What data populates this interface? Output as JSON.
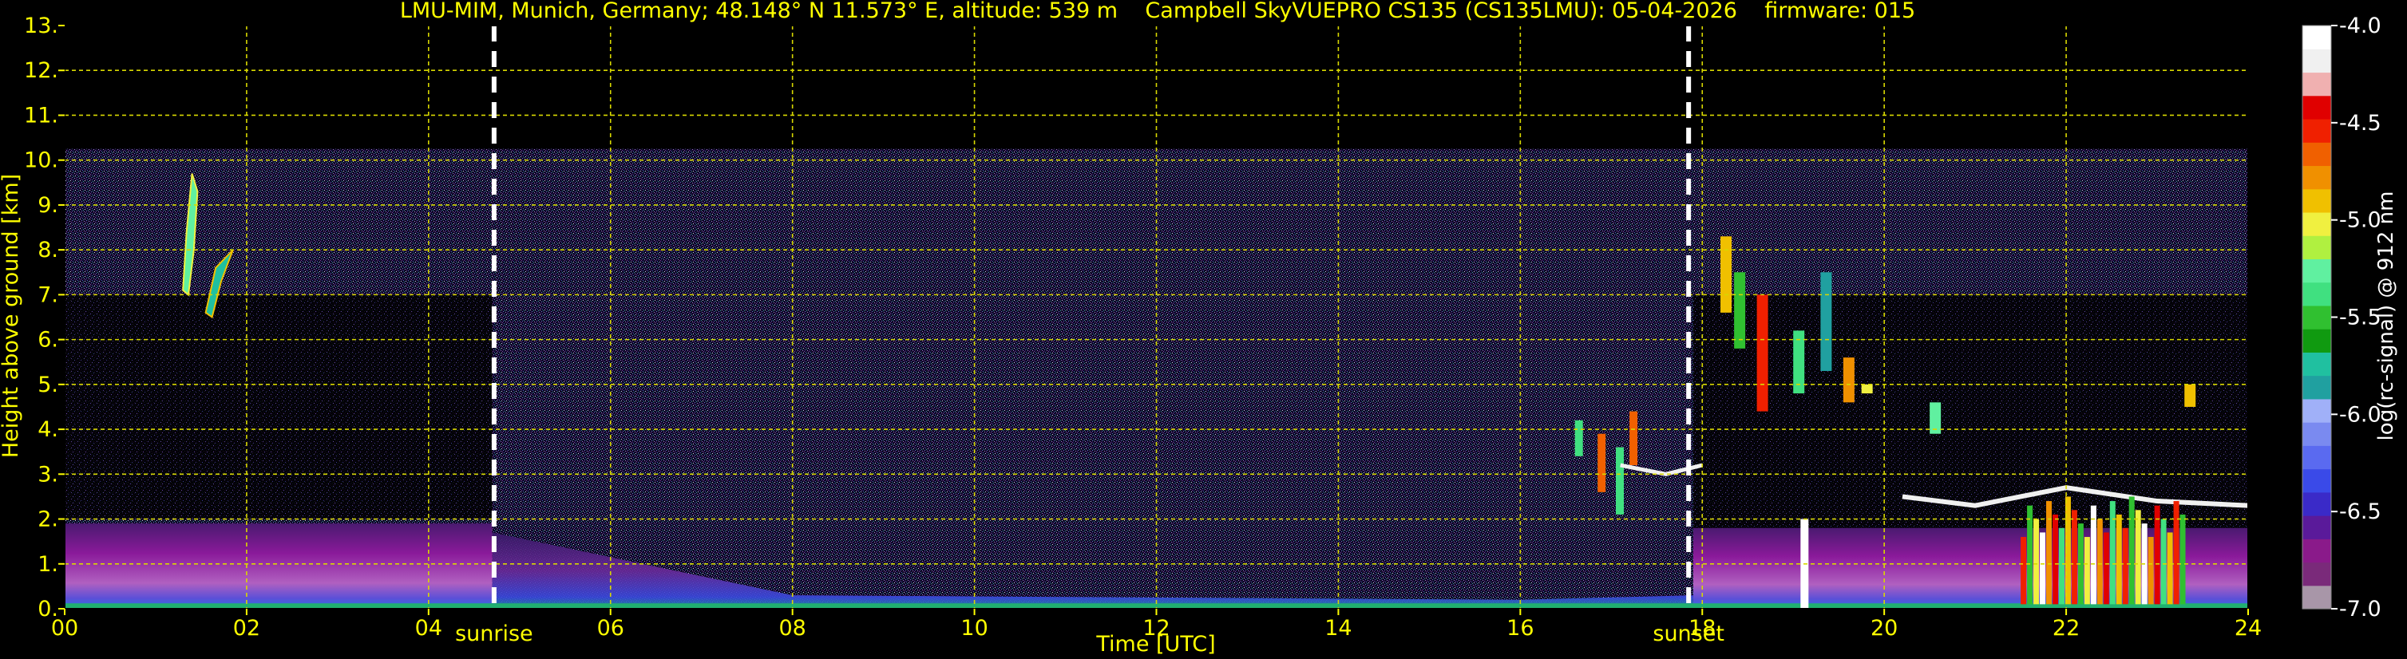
{
  "chart_data": {
    "type": "heatmap",
    "title": "LMU-MIM, Munich, Germany; 48.148° N 11.573° E, altitude: 539 m    Campbell SkyVUEPRO CS135 (CS135LMU): 05-04-2026    firmware: 015",
    "xlabel": "Time [UTC]",
    "ylabel": "Height above ground [km]",
    "xlim": [
      0,
      24
    ],
    "ylim": [
      0,
      13
    ],
    "x_ticks": [
      "00",
      "02",
      "04",
      "06",
      "08",
      "10",
      "12",
      "14",
      "16",
      "18",
      "20",
      "22",
      "24"
    ],
    "x_tick_values": [
      0,
      2,
      4,
      6,
      8,
      10,
      12,
      14,
      16,
      18,
      20,
      22,
      24
    ],
    "y_ticks": [
      "0.",
      "1.",
      "2.",
      "3.",
      "4.",
      "5.",
      "6.",
      "7.",
      "8.",
      "9.",
      "10.",
      "11.",
      "12.",
      "13."
    ],
    "y_tick_values": [
      0,
      1,
      2,
      3,
      4,
      5,
      6,
      7,
      8,
      9,
      10,
      11,
      12,
      13
    ],
    "grid": true,
    "data_top_km": 10.25,
    "markers": [
      {
        "label": "sunrise",
        "x": 4.72
      },
      {
        "label": "sunset",
        "x": 17.85
      }
    ],
    "colorbar": {
      "label": "log(rc-signal) @ 912 nm",
      "range": [
        -7.0,
        -4.0
      ],
      "ticks": [
        "-4.0",
        "-4.5",
        "-5.0",
        "-5.5",
        "-6.0",
        "-6.5",
        "-7.0"
      ],
      "tick_values": [
        -4.0,
        -4.5,
        -5.0,
        -5.5,
        -6.0,
        -6.5,
        -7.0
      ],
      "colors": [
        "#a896a8",
        "#7a2a7a",
        "#8a1a8a",
        "#5a1a9a",
        "#3a2ac8",
        "#3a4ae8",
        "#5a6af0",
        "#7a8af0",
        "#a0b0f8",
        "#20a0a0",
        "#20c0a0",
        "#109a10",
        "#30c030",
        "#40e080",
        "#60f0a0",
        "#b0f040",
        "#f0f040",
        "#f0c000",
        "#f09000",
        "#f06000",
        "#f02000",
        "#e00000",
        "#f0b0b0",
        "#f0f0f0",
        "#ffffff"
      ]
    },
    "features": [
      {
        "type": "boundary_layer",
        "x_start": 0,
        "x_end": 4.5,
        "height_top_km": 1.9
      },
      {
        "type": "cirrus",
        "x_range": [
          1.3,
          1.9
        ],
        "height_km": [
          6.5,
          9.7
        ]
      },
      {
        "type": "clouds",
        "x_range": [
          16.5,
          17.3
        ],
        "height_km": [
          2.0,
          4.5
        ]
      },
      {
        "type": "clouds",
        "x_range": [
          18.0,
          24.0
        ],
        "height_km": [
          2.0,
          8.5
        ]
      },
      {
        "type": "precipitation",
        "x_range": [
          21.5,
          23.3
        ],
        "height_km": [
          0.0,
          2.6
        ]
      }
    ]
  }
}
